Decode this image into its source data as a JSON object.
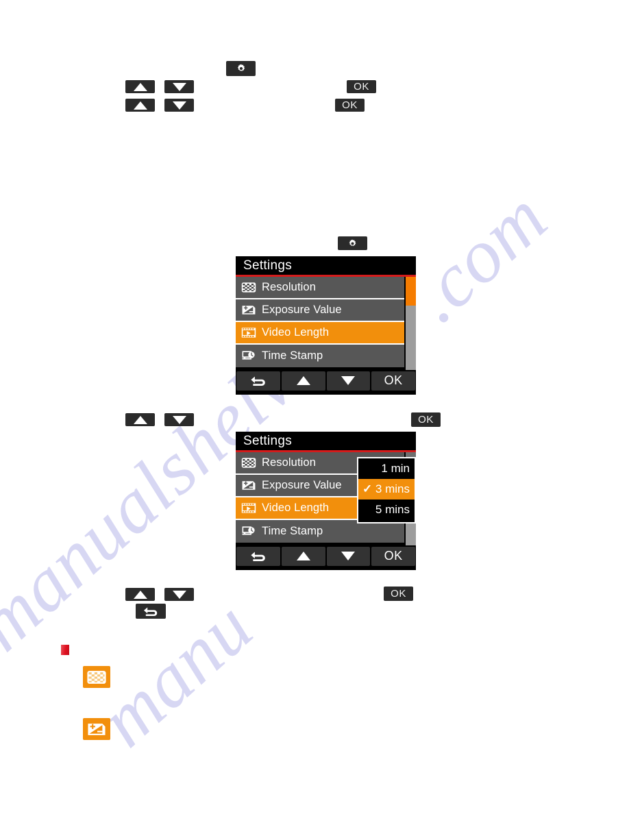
{
  "page": {
    "background_color": "#ffffff",
    "watermark_fragments": [
      ".com",
      "manu",
      "manualshelve"
    ]
  },
  "colors": {
    "accent_orange": "#f28f0c",
    "title_rule_red": "#d51b1b",
    "row_gray": "#575757",
    "screen_black": "#000000",
    "key_dark": "#2b2b2b",
    "scrollbar_track": "#9d9d9d",
    "scrollbar_thumb": "#f57c00"
  },
  "top_keys": {
    "gear": {
      "icon": "gear-icon",
      "label": ""
    },
    "row1": {
      "up": {
        "icon": "triangle-up-icon"
      },
      "down": {
        "icon": "triangle-down-icon"
      },
      "ok": {
        "label": "OK"
      }
    },
    "row2": {
      "up": {
        "icon": "triangle-up-icon"
      },
      "down": {
        "icon": "triangle-down-icon"
      },
      "ok": {
        "label": "OK"
      }
    }
  },
  "mid_gear_key": {
    "icon": "gear-icon"
  },
  "screen_one": {
    "title": "Settings",
    "rows": [
      {
        "label": "Resolution",
        "icon": "checkerboard-resolution-icon",
        "selected": false
      },
      {
        "label": "Exposure Value",
        "icon": "exposure-value-icon",
        "selected": false
      },
      {
        "label": "Video Length",
        "icon": "film-strip-video-icon",
        "selected": true
      },
      {
        "label": "Time Stamp",
        "icon": "time-stamp-icon",
        "selected": false
      }
    ],
    "softkeys": [
      {
        "name": "back",
        "icon": "back-arrow-icon",
        "label": ""
      },
      {
        "name": "up",
        "icon": "triangle-up-icon",
        "label": ""
      },
      {
        "name": "down",
        "icon": "triangle-down-icon",
        "label": ""
      },
      {
        "name": "ok",
        "icon": "",
        "label": "OK"
      }
    ],
    "scrollbar": {
      "thumb_position": "top"
    }
  },
  "mid_keys": {
    "up": {
      "icon": "triangle-up-icon"
    },
    "down": {
      "icon": "triangle-down-icon"
    },
    "ok": {
      "label": "OK"
    }
  },
  "screen_two": {
    "title": "Settings",
    "rows": [
      {
        "label": "Resolution",
        "icon": "checkerboard-resolution-icon",
        "selected": false
      },
      {
        "label": "Exposure Value",
        "icon": "exposure-value-icon",
        "selected": false
      },
      {
        "label": "Video Length",
        "icon": "film-strip-video-icon",
        "selected": true
      },
      {
        "label": "Time Stamp",
        "icon": "time-stamp-icon",
        "selected": false
      }
    ],
    "dropdown": {
      "options": [
        {
          "label": "1 min",
          "checked": false
        },
        {
          "label": "3 mins",
          "checked": true
        },
        {
          "label": "5 mins",
          "checked": false
        }
      ],
      "check_glyph": "✓"
    },
    "softkeys": [
      {
        "name": "back",
        "icon": "back-arrow-icon",
        "label": ""
      },
      {
        "name": "up",
        "icon": "triangle-up-icon",
        "label": ""
      },
      {
        "name": "down",
        "icon": "triangle-down-icon",
        "label": ""
      },
      {
        "name": "ok",
        "icon": "",
        "label": "OK"
      }
    ]
  },
  "bottom_keys": {
    "up": {
      "icon": "triangle-up-icon"
    },
    "down": {
      "icon": "triangle-down-icon"
    },
    "ok": {
      "label": "OK"
    },
    "back": {
      "icon": "back-arrow-icon"
    }
  },
  "legend": {
    "red_chip": {
      "icon": "red-square-bullet-icon"
    },
    "items": [
      {
        "icon": "checkerboard-resolution-icon",
        "label": ""
      },
      {
        "icon": "exposure-value-icon",
        "label": ""
      }
    ]
  }
}
